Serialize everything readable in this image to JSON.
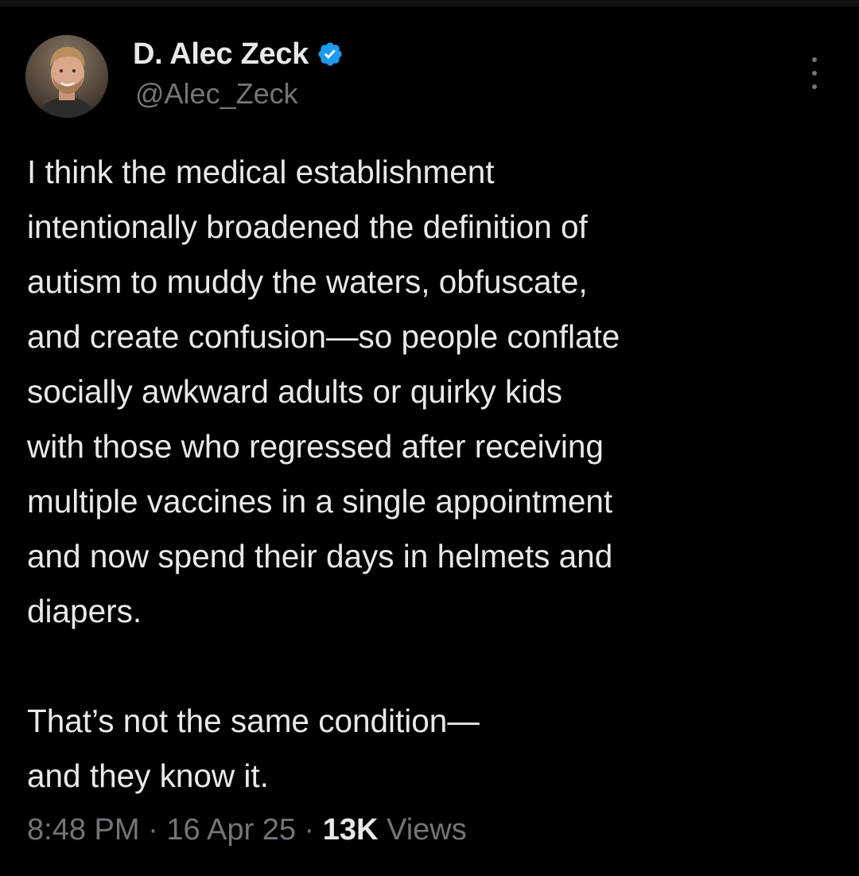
{
  "author": {
    "display_name": "D. Alec Zeck",
    "handle": "@Alec_Zeck",
    "verified_icon": "verified-badge-icon",
    "verified_color": "#1d9bf0"
  },
  "more_icon": "more-options-icon",
  "tweet": {
    "lines": [
      "I think the medical establishment",
      "intentionally broadened the definition of",
      "autism to muddy the waters, obfuscate,",
      "and create confusion—so people conflate",
      "socially awkward adults or quirky kids",
      "with those who regressed after receiving",
      "multiple vaccines in a single appointment",
      "and now spend their days in helmets and",
      "diapers."
    ],
    "lines_2": [
      "That’s not the same condition—",
      "and they know it."
    ]
  },
  "meta": {
    "time": "8:48 PM",
    "separator": " · ",
    "date": "16 Apr 25",
    "views_count": "13K",
    "views_label": " Views"
  },
  "colors": {
    "background": "#000000",
    "text": "#e7e9ea",
    "secondary": "#71767b"
  }
}
